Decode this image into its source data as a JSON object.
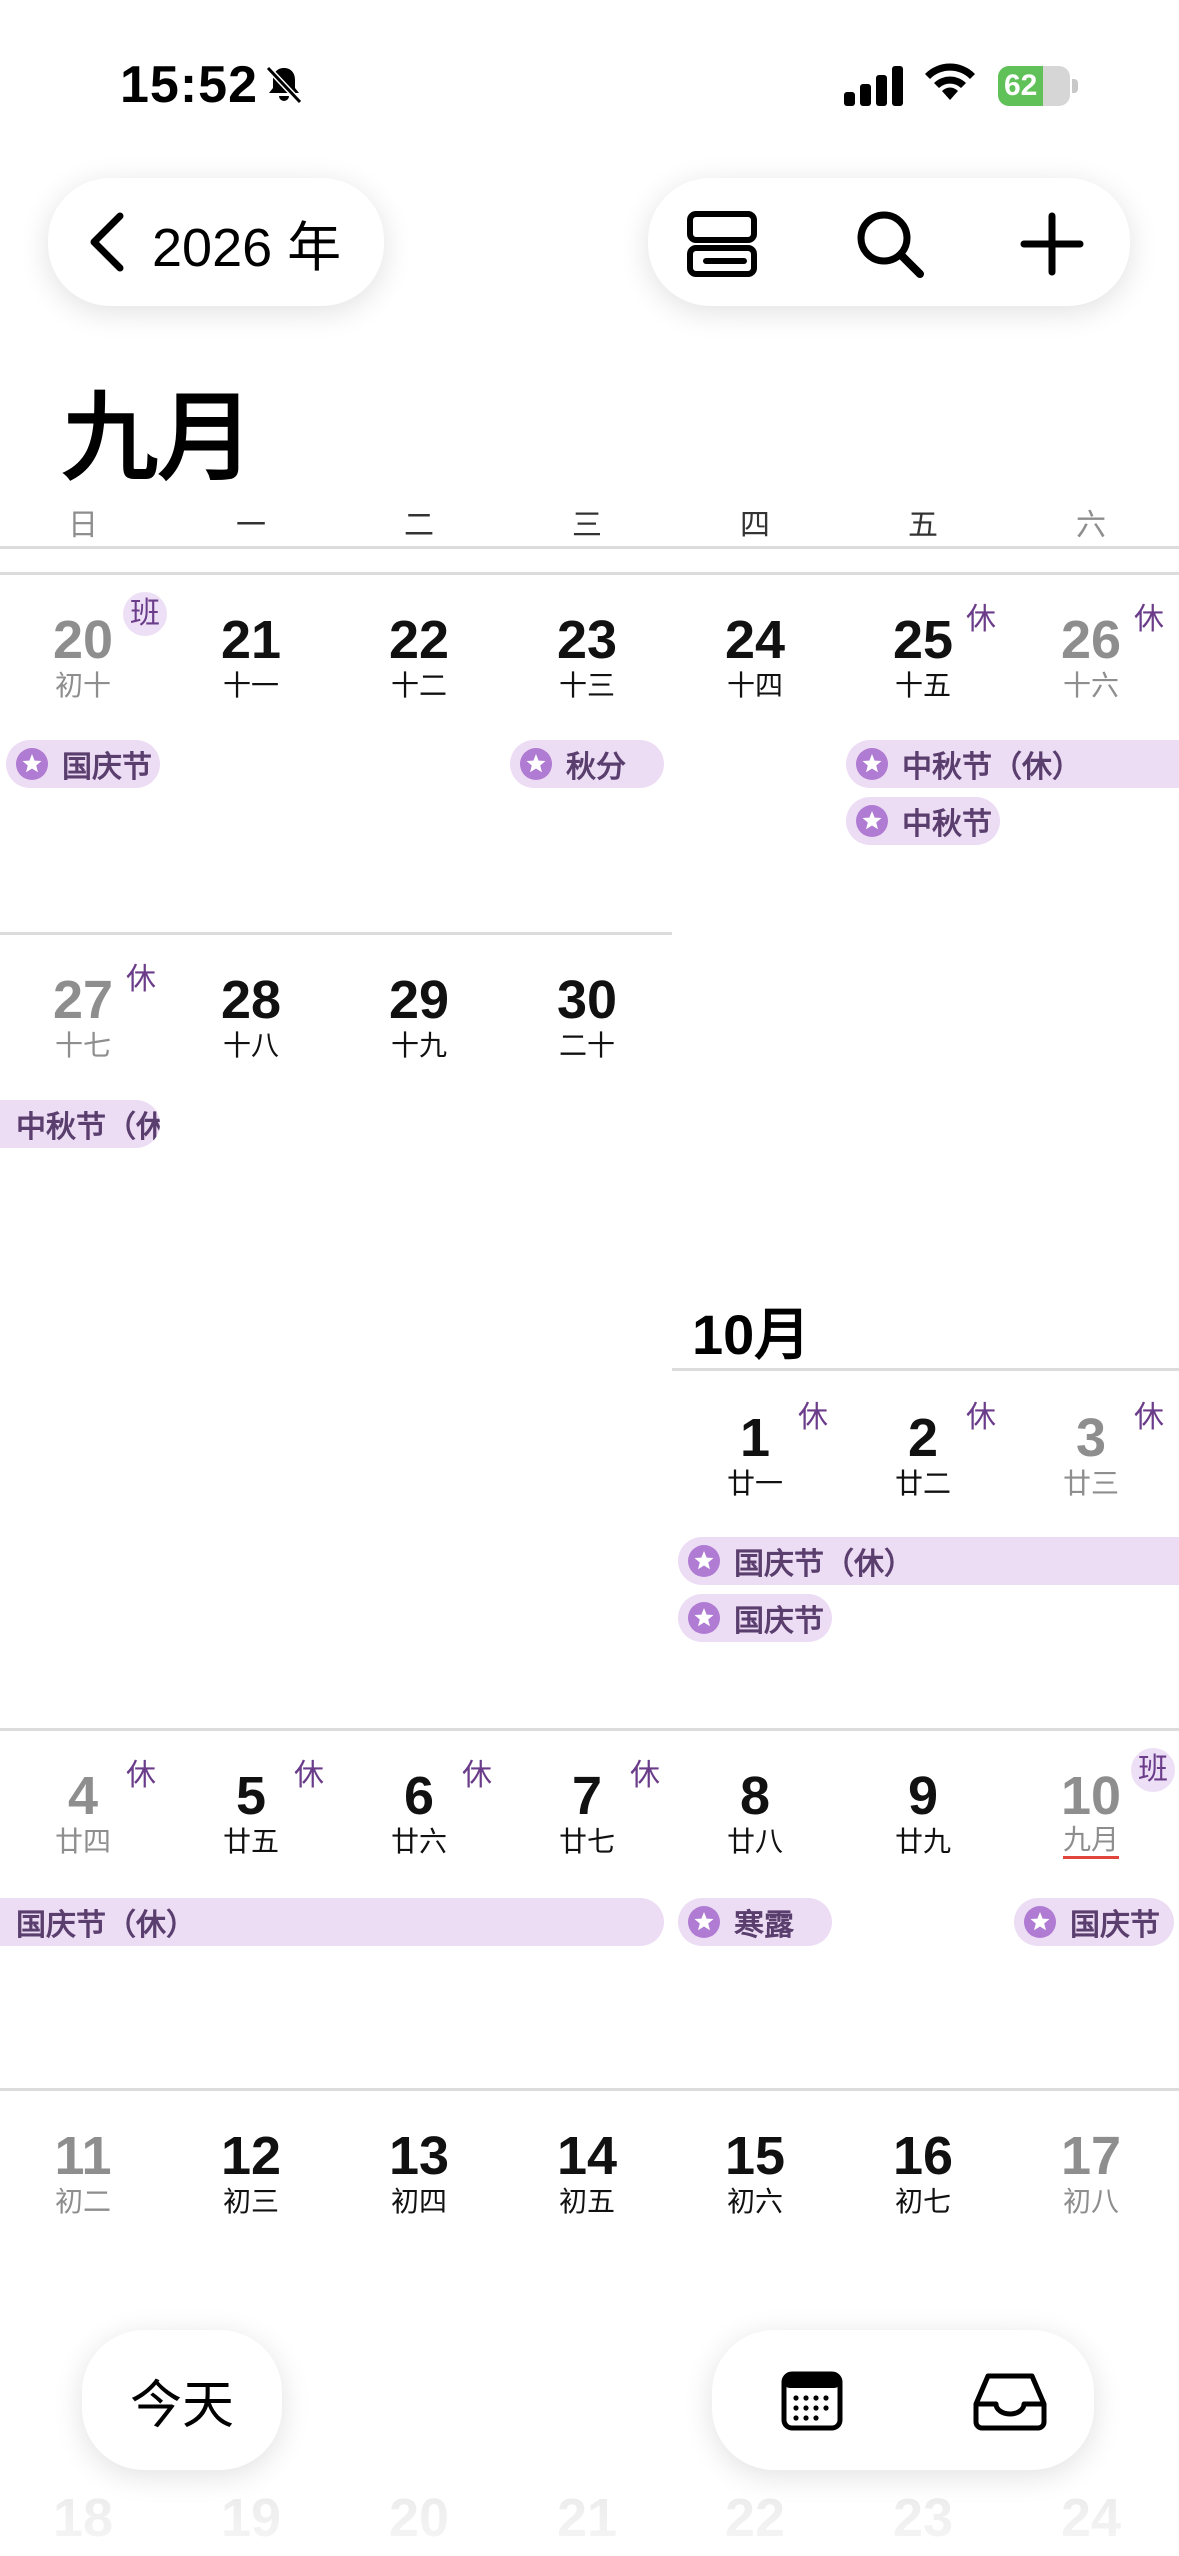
{
  "status_bar": {
    "time": "15:52",
    "battery_level": "62",
    "battery_fraction": 0.62
  },
  "header": {
    "back_label": "2026 年",
    "month_title": "九月"
  },
  "weekdays": [
    "日",
    "一",
    "二",
    "三",
    "四",
    "五",
    "六"
  ],
  "weeks": [
    {
      "days": [
        {
          "num": "20",
          "lunar": "初十",
          "badge": "班"
        },
        {
          "num": "21",
          "lunar": "十一"
        },
        {
          "num": "22",
          "lunar": "十二"
        },
        {
          "num": "23",
          "lunar": "十三"
        },
        {
          "num": "24",
          "lunar": "十四"
        },
        {
          "num": "25",
          "lunar": "十五",
          "badge": "休"
        },
        {
          "num": "26",
          "lunar": "十六",
          "badge": "休"
        }
      ],
      "events": [
        {
          "label": "国庆节"
        },
        {
          "label": "秋分"
        },
        {
          "label": "中秋节（休）"
        },
        {
          "label": "中秋节"
        }
      ]
    },
    {
      "days": [
        {
          "num": "27",
          "lunar": "十七",
          "badge": "休"
        },
        {
          "num": "28",
          "lunar": "十八"
        },
        {
          "num": "29",
          "lunar": "十九"
        },
        {
          "num": "30",
          "lunar": "二十"
        }
      ],
      "events": [
        {
          "label": "中秋节（休）"
        }
      ]
    },
    {
      "month_label": "10月",
      "days": [
        {
          "num": "1",
          "lunar": "廿一",
          "badge": "休"
        },
        {
          "num": "2",
          "lunar": "廿二",
          "badge": "休"
        },
        {
          "num": "3",
          "lunar": "廿三",
          "badge": "休"
        }
      ],
      "events": [
        {
          "label": "国庆节（休）"
        },
        {
          "label": "国庆节"
        }
      ]
    },
    {
      "days": [
        {
          "num": "4",
          "lunar": "廿四",
          "badge": "休"
        },
        {
          "num": "5",
          "lunar": "廿五",
          "badge": "休"
        },
        {
          "num": "6",
          "lunar": "廿六",
          "badge": "休"
        },
        {
          "num": "7",
          "lunar": "廿七",
          "badge": "休"
        },
        {
          "num": "8",
          "lunar": "廿八"
        },
        {
          "num": "9",
          "lunar": "廿九"
        },
        {
          "num": "10",
          "lunar": "九月",
          "badge": "班"
        }
      ],
      "events": [
        {
          "label": "国庆节（休）"
        },
        {
          "label": "寒露"
        },
        {
          "label": "国庆节"
        }
      ]
    },
    {
      "days": [
        {
          "num": "11",
          "lunar": "初二"
        },
        {
          "num": "12",
          "lunar": "初三"
        },
        {
          "num": "13",
          "lunar": "初四"
        },
        {
          "num": "14",
          "lunar": "初五"
        },
        {
          "num": "15",
          "lunar": "初六"
        },
        {
          "num": "16",
          "lunar": "初七"
        },
        {
          "num": "17",
          "lunar": "初八"
        }
      ]
    },
    {
      "days": [
        {
          "num": "18"
        },
        {
          "num": "19"
        },
        {
          "num": "20"
        },
        {
          "num": "21"
        },
        {
          "num": "22"
        },
        {
          "num": "23"
        },
        {
          "num": "24"
        }
      ]
    }
  ],
  "bottom_bar": {
    "today_label": "今天"
  },
  "icons": {
    "back": "chevron-left-icon",
    "view": "list-view-icon",
    "search": "search-icon",
    "add": "plus-icon",
    "calendar": "calendar-icon",
    "inbox": "inbox-tray-icon",
    "mute": "bell-slash-icon",
    "event": "star-icon"
  },
  "colors": {
    "event_bg": "#ecdcf4",
    "event_star": "#b07bd3",
    "badge_text": "#6a3c8a",
    "battery_fill": "#60c159",
    "today_underline": "#e0443a"
  }
}
